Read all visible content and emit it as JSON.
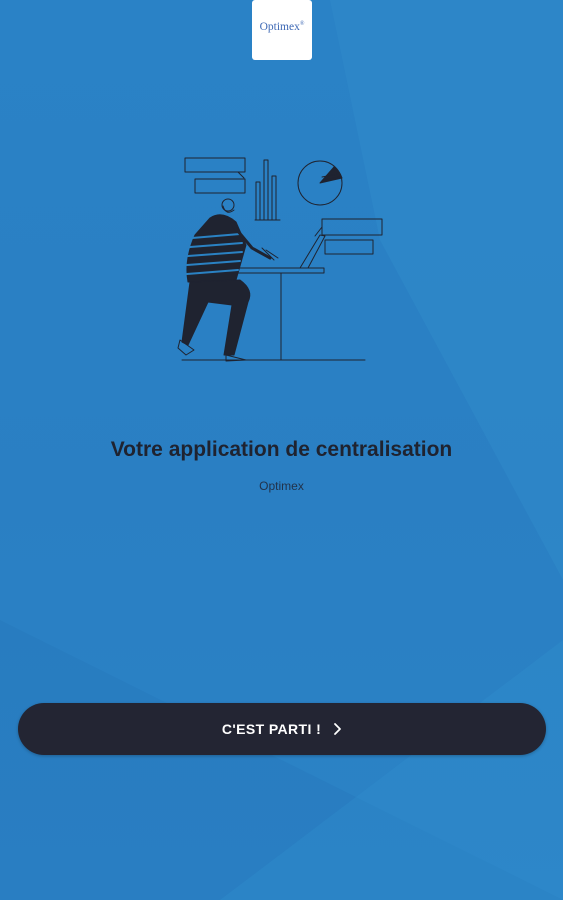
{
  "logo": {
    "text": "Optimex",
    "mark": "®"
  },
  "onboarding": {
    "headline": "Votre application de centralisation",
    "subtitle": "Optimex"
  },
  "cta": {
    "label": "C'EST PARTI !",
    "icon": "chevron-right-icon"
  },
  "colors": {
    "background": "#2a82c4",
    "button": "#232533",
    "headline": "#1f2330",
    "logo_text": "#3d68b4"
  }
}
